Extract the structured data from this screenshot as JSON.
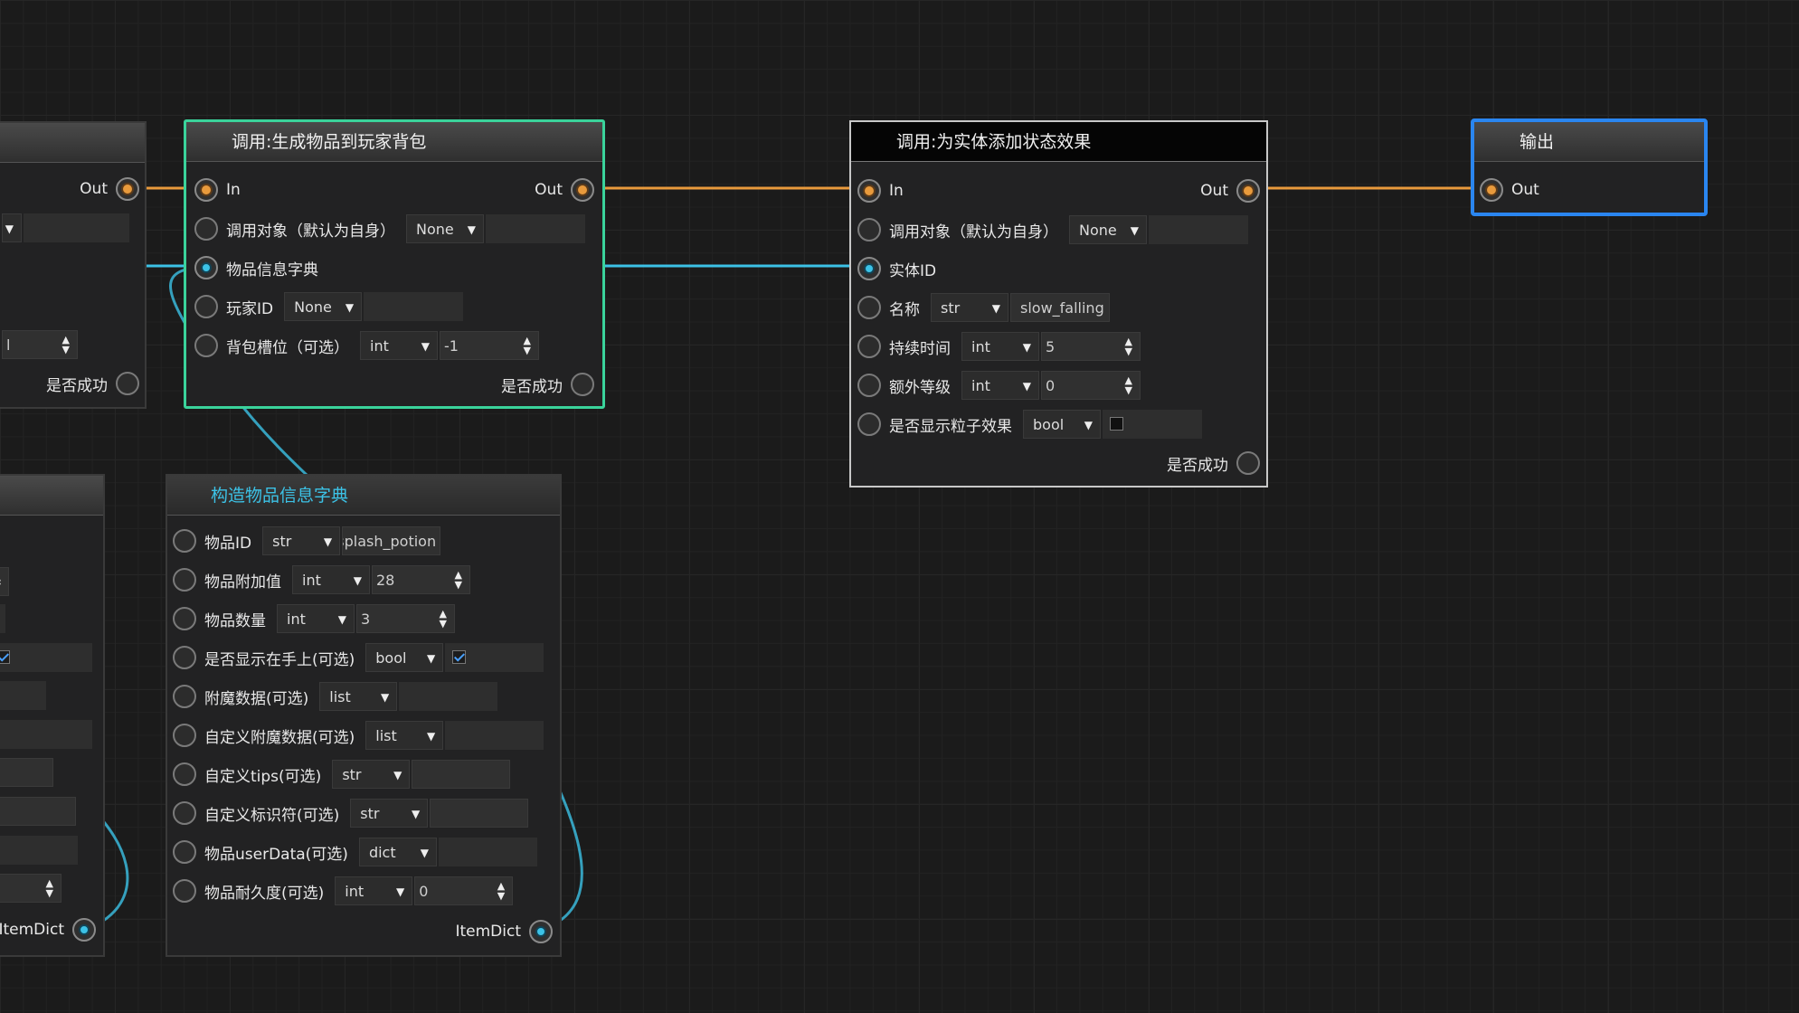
{
  "colors": {
    "exec_wire": "#e89a3c",
    "data_wire": "#3cc2e6",
    "select_green": "#3ad39b",
    "select_blue": "#2a86f0",
    "background": "#1b1b1b"
  },
  "left_partial": {
    "out_label": "Out",
    "success_label": "是否成功",
    "item_dict_label": "ItemDict",
    "value_fragment": "l"
  },
  "node_give_item": {
    "title": "调用:生成物品到玩家背包",
    "in_label": "In",
    "out_label": "Out",
    "target_label": "调用对象（默认为自身）",
    "target_value": "None",
    "item_dict_label": "物品信息字典",
    "player_label": "玩家ID",
    "player_value": "None",
    "slot_label": "背包槽位（可选）",
    "slot_type": "int",
    "slot_value": "-1",
    "success_label": "是否成功"
  },
  "node_build_dict": {
    "title": "构造物品信息字典",
    "rows": [
      {
        "label": "物品ID",
        "type": "str",
        "value": "splash_potion"
      },
      {
        "label": "物品附加值",
        "type": "int",
        "value": "28"
      },
      {
        "label": "物品数量",
        "type": "int",
        "value": "3"
      },
      {
        "label": "是否显示在手上(可选)",
        "type": "bool",
        "value": ""
      },
      {
        "label": "附魔数据(可选)",
        "type": "list",
        "value": ""
      },
      {
        "label": "自定义附魔数据(可选)",
        "type": "list",
        "value": ""
      },
      {
        "label": "自定义tips(可选)",
        "type": "str",
        "value": ""
      },
      {
        "label": "自定义标识符(可选)",
        "type": "str",
        "value": ""
      },
      {
        "label": "物品userData(可选)",
        "type": "dict",
        "value": ""
      },
      {
        "label": "物品耐久度(可选)",
        "type": "int",
        "value": "0"
      }
    ],
    "output_label": "ItemDict"
  },
  "node_add_effect": {
    "title": "调用:为实体添加状态效果",
    "in_label": "In",
    "out_label": "Out",
    "target_label": "调用对象（默认为自身）",
    "target_value": "None",
    "entity_label": "实体ID",
    "name_label": "名称",
    "name_type": "str",
    "name_value": "slow_falling",
    "duration_label": "持续时间",
    "duration_type": "int",
    "duration_value": "5",
    "amplifier_label": "额外等级",
    "amplifier_type": "int",
    "amplifier_value": "0",
    "particles_label": "是否显示粒子效果",
    "particles_type": "bool",
    "success_label": "是否成功"
  },
  "node_output": {
    "title": "输出",
    "out_label": "Out"
  }
}
